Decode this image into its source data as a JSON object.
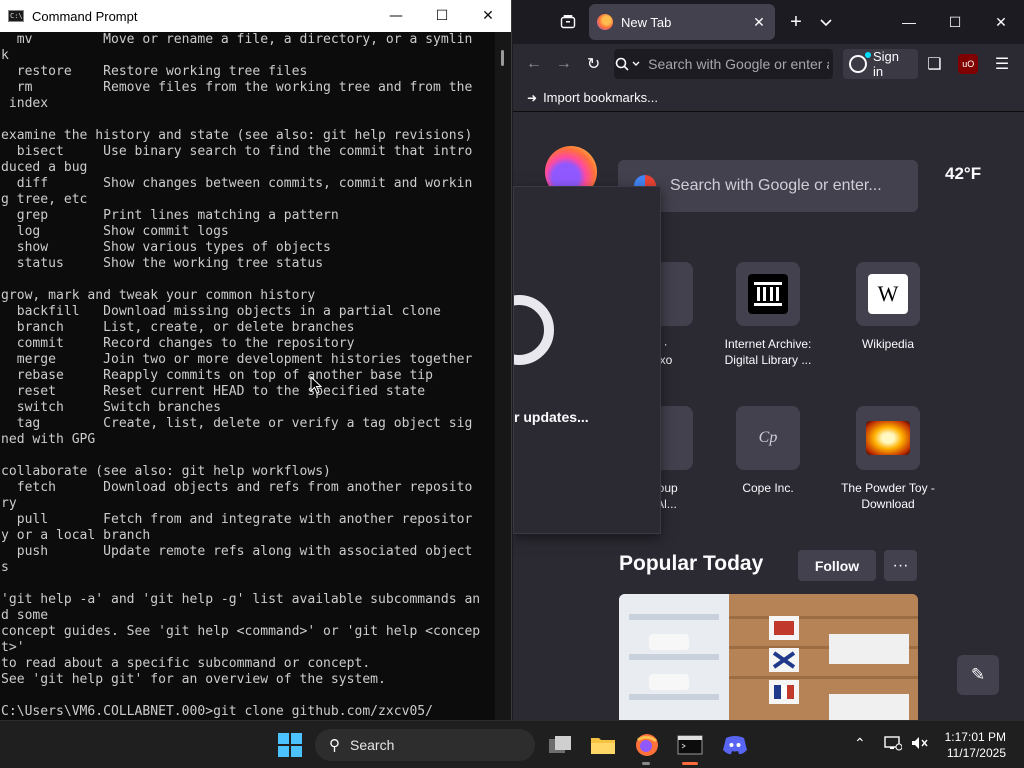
{
  "cmd": {
    "title": "Command Prompt",
    "output": "  mv         Move or rename a file, a directory, or a symlin\nk\n  restore    Restore working tree files\n  rm         Remove files from the working tree and from the\n index\n\nexamine the history and state (see also: git help revisions)\n  bisect     Use binary search to find the commit that intro\nduced a bug\n  diff       Show changes between commits, commit and workin\ng tree, etc\n  grep       Print lines matching a pattern\n  log        Show commit logs\n  show       Show various types of objects\n  status     Show the working tree status\n\ngrow, mark and tweak your common history\n  backfill   Download missing objects in a partial clone\n  branch     List, create, or delete branches\n  commit     Record changes to the repository\n  merge      Join two or more development histories together\n  rebase     Reapply commits on top of another base tip\n  reset      Reset current HEAD to the specified state\n  switch     Switch branches\n  tag        Create, list, delete or verify a tag object sig\nned with GPG\n\ncollaborate (see also: git help workflows)\n  fetch      Download objects and refs from another reposito\nry\n  pull       Fetch from and integrate with another repositor\ny or a local branch\n  push       Update remote refs along with associated object\ns\n\n'git help -a' and 'git help -g' list available subcommands an\nd some\nconcept guides. See 'git help <command>' or 'git help <concep\nt>'\nto read about a specific subcommand or concept.\nSee 'git help git' for an overview of the system.\n\nC:\\Users\\VM6.COLLABNET.000>git clone github.com/zxcv05/"
  },
  "firefox": {
    "tab_label": "New Tab",
    "url_placeholder": "Search with Google or enter address",
    "signin_label": "Sign in",
    "ublock_badge": "uO",
    "import_bookmarks": "Import bookmarks...",
    "search_placeholder": "Search with Google or enter...",
    "weather": "42°F",
    "popup_text": "r updates...",
    "tiles": [
      {
        "line1": "s ·",
        "line2": "foxo"
      },
      {
        "line1": "Internet Archive:",
        "line2": "Digital Library ..."
      },
      {
        "line1": "Wikipedia",
        "line2": ""
      },
      {
        "line1": "Group",
        "line2": "'s Al..."
      },
      {
        "line1": "Cope Inc.",
        "line2": ""
      },
      {
        "line1": "The Powder Toy -",
        "line2": "Download"
      }
    ],
    "wikipedia_glyph": "W",
    "cope_glyph": "Cp",
    "popular_title": "Popular Today",
    "follow_label": "Follow",
    "more_glyph": "···"
  },
  "taskbar": {
    "search_label": "Search",
    "time": "1:17:01 PM",
    "date": "11/17/2025"
  },
  "colors": {
    "accent_blue": "#4cc2ff",
    "firefox_bg": "#2b2a33",
    "cmd_text": "#cccccc",
    "active_indicator": "#ff6b3d"
  }
}
